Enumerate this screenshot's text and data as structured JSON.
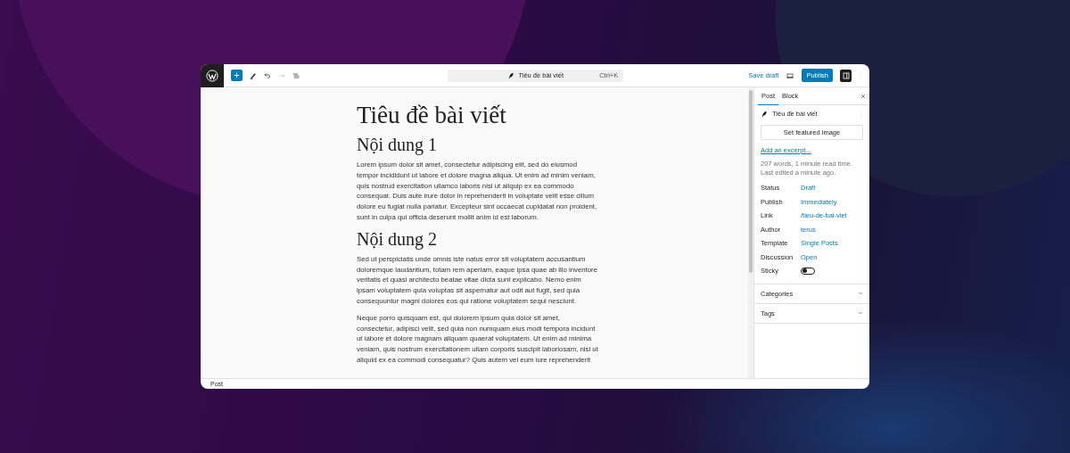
{
  "toolbar": {
    "inserter_open": false,
    "command_bar": {
      "title": "Tiêu đề bài viết",
      "shortcut": "Ctrl+K"
    },
    "save_draft": "Save draft",
    "publish": "Publish",
    "settings_open": true
  },
  "editor": {
    "title": "Tiêu đề bài viết",
    "blocks": [
      {
        "kind": "heading",
        "text": "Nội dung 1"
      },
      {
        "kind": "paragraph",
        "text": "Lorem ipsum dolor sit amet, consectetur adipiscing elit, sed do eiusmod tempor incididunt ut labore et dolore magna aliqua. Ut enim ad minim veniam, quis nostrud exercitation ullamco laboris nisi ut aliquip ex ea commodo consequat. Duis aute irure dolor in reprehenderit in voluptate velit esse cillum dolore eu fugiat nulla pariatur. Excepteur sint occaecat cupidatat non proident, sunt in culpa qui officia deserunt mollit anim id est laborum."
      },
      {
        "kind": "heading",
        "text": "Nội dung 2"
      },
      {
        "kind": "paragraph",
        "text": "Sed ut perspiciatis unde omnis iste natus error sit voluptatem accusantium doloremque laudantium, totam rem aperiam, eaque ipsa quae ab illo inventore veritatis et quasi architecto beatae vitae dicta sunt explicabo. Nemo enim ipsam voluptatem quia voluptas sit aspernatur aut odit aut fugit, sed quia consequuntur magni dolores eos qui ratione voluptatem sequi nesciunt."
      },
      {
        "kind": "paragraph",
        "text": "Neque porro quisquam est, qui dolorem ipsum quia dolor sit amet, consectetur, adipisci velit, sed quia non numquam eius modi tempora incidunt ut labore et dolore magnam aliquam quaerat voluptatem. Ut enim ad minima veniam, quis nostrum exercitationem ullam corporis suscipit laboriosam, nisi ut aliquid ex ea commodi consequatur? Quis autem vel eum iure reprehenderit"
      }
    ]
  },
  "sidebar": {
    "tabs": [
      {
        "label": "Post",
        "selected": true
      },
      {
        "label": "Block",
        "selected": false
      }
    ],
    "post_title": "Tiêu đề bài viết",
    "featured_image_button": "Set featured image",
    "excerpt_link": "Add an excerpt...",
    "stats": [
      "207 words, 1 minute read time.",
      "Last edited a minute ago."
    ],
    "fields": [
      {
        "label": "Status",
        "value": "Draft"
      },
      {
        "label": "Publish",
        "value": "Immediately"
      },
      {
        "label": "Link",
        "value": "/tieu-de-bai-viet"
      },
      {
        "label": "Author",
        "value": "terus"
      },
      {
        "label": "Template",
        "value": "Single Posts"
      },
      {
        "label": "Discussion",
        "value": "Open"
      }
    ],
    "sticky": {
      "label": "Sticky",
      "on": false
    },
    "panels": [
      {
        "label": "Categories",
        "expanded": false
      },
      {
        "label": "Tags",
        "expanded": false
      }
    ]
  },
  "status_bar": {
    "breadcrumb": "Post"
  }
}
